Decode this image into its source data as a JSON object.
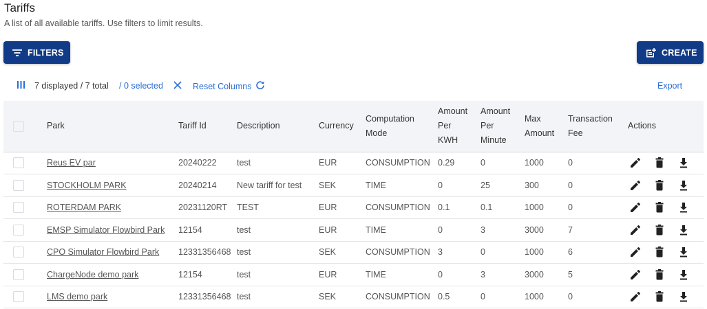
{
  "page": {
    "title": "Tariffs",
    "subtitle": "A list of all available tariffs. Use filters to limit results."
  },
  "toolbar": {
    "filters_label": "FILTERS",
    "create_label": "CREATE",
    "displayed": "7 displayed / 7 total",
    "selected": "/ 0 selected",
    "reset_columns": "Reset Columns",
    "export": "Export"
  },
  "colors": {
    "primary": "#123b87",
    "link": "#2a6cd6"
  },
  "table": {
    "headers": {
      "park": "Park",
      "tariff_id": "Tariff Id",
      "description": "Description",
      "currency": "Currency",
      "computation_mode_1": "Computation",
      "computation_mode_2": "Mode",
      "amount_kwh_1": "Amount",
      "amount_kwh_2": "Per",
      "amount_kwh_3": "KWH",
      "amount_min_1": "Amount",
      "amount_min_2": "Per",
      "amount_min_3": "Minute",
      "max_amount_1": "Max",
      "max_amount_2": "Amount",
      "transaction_fee_1": "Transaction",
      "transaction_fee_2": "Fee",
      "actions": "Actions"
    },
    "rows": [
      {
        "park": "Reus EV par",
        "tariff_id": "20240222",
        "description": "test",
        "currency": "EUR",
        "mode": "CONSUMPTION",
        "per_kwh": "0.29",
        "per_minute": "0",
        "max_amount": "1000",
        "fee": "0"
      },
      {
        "park": "STOCKHOLM PARK",
        "tariff_id": "20240214",
        "description": "New tariff for test",
        "currency": "SEK",
        "mode": "TIME",
        "per_kwh": "0",
        "per_minute": "25",
        "max_amount": "300",
        "fee": "0"
      },
      {
        "park": "ROTERDAM PARK",
        "tariff_id": "20231120RT",
        "description": "TEST",
        "currency": "EUR",
        "mode": "CONSUMPTION",
        "per_kwh": "0.1",
        "per_minute": "0.1",
        "max_amount": "1000",
        "fee": "0"
      },
      {
        "park": "EMSP Simulator Flowbird Park",
        "tariff_id": "12154",
        "description": "test",
        "currency": "EUR",
        "mode": "TIME",
        "per_kwh": "0",
        "per_minute": "3",
        "max_amount": "3000",
        "fee": "7"
      },
      {
        "park": "CPO Simulator Flowbird Park",
        "tariff_id": "12331356468",
        "description": "test",
        "currency": "SEK",
        "mode": "CONSUMPTION",
        "per_kwh": "3",
        "per_minute": "0",
        "max_amount": "1000",
        "fee": "6"
      },
      {
        "park": "ChargeNode demo park",
        "tariff_id": "12154",
        "description": "test",
        "currency": "EUR",
        "mode": "TIME",
        "per_kwh": "0",
        "per_minute": "3",
        "max_amount": "3000",
        "fee": "5"
      },
      {
        "park": "LMS demo park",
        "tariff_id": "12331356468",
        "description": "test",
        "currency": "SEK",
        "mode": "CONSUMPTION",
        "per_kwh": "0.5",
        "per_minute": "0",
        "max_amount": "1000",
        "fee": "0"
      }
    ]
  }
}
